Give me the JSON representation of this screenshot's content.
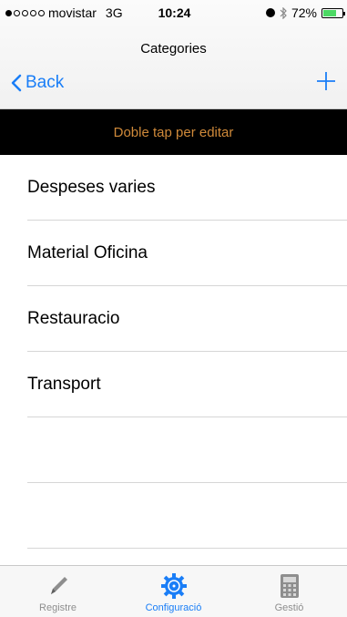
{
  "status": {
    "carrier": "movistar",
    "network": "3G",
    "time": "10:24",
    "battery": "72%",
    "battery_level": 0.72,
    "battery_color": "#4cd964"
  },
  "nav": {
    "title": "Categories",
    "back_label": "Back",
    "add_icon": "plus-icon"
  },
  "banner": {
    "text": "Doble tap per editar"
  },
  "categories": [
    "Despeses varies",
    "Material Oficina",
    "Restauracio",
    "Transport"
  ],
  "tabs": [
    {
      "label": "Registre",
      "icon": "pencil-icon",
      "active": false
    },
    {
      "label": "Configuració",
      "icon": "gear-icon",
      "active": true
    },
    {
      "label": "Gestió",
      "icon": "calculator-icon",
      "active": false
    }
  ],
  "colors": {
    "accent": "#1a7ef7",
    "banner_bg": "#000000",
    "banner_text": "#d08a3a"
  }
}
